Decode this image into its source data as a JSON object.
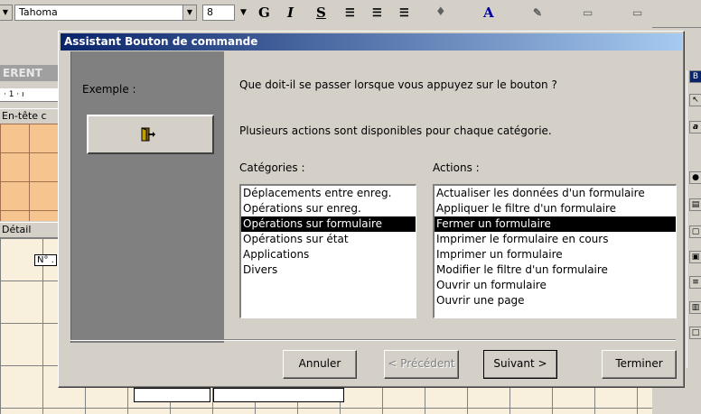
{
  "toolbar": {
    "font_name": "Tahoma",
    "font_size": "8",
    "bold_glyph": "G",
    "italic_glyph": "I",
    "underline_glyph": "S",
    "font_color_glyph": "A"
  },
  "background": {
    "title_fragment": "ERENT",
    "ruler_text": "· 1 · ı",
    "header_section": "En-tête c",
    "detail_section": "Détail",
    "field_fragment": "N° ."
  },
  "dialog": {
    "title": "Assistant Bouton de commande",
    "example_label": "Exemple :",
    "question": "Que doit-il se passer lorsque vous appuyez sur le bouton ?",
    "info": "Plusieurs actions sont disponibles pour chaque catégorie.",
    "categories_label": "Catégories :",
    "actions_label": "Actions :",
    "categories": [
      {
        "label": "Déplacements entre enreg.",
        "selected": false
      },
      {
        "label": "Opérations sur enreg.",
        "selected": false
      },
      {
        "label": "Opérations sur formulaire",
        "selected": true
      },
      {
        "label": "Opérations sur état",
        "selected": false
      },
      {
        "label": "Applications",
        "selected": false
      },
      {
        "label": "Divers",
        "selected": false
      }
    ],
    "actions": [
      {
        "label": "Actualiser les données d'un formulaire",
        "selected": false
      },
      {
        "label": "Appliquer le filtre d'un formulaire",
        "selected": false
      },
      {
        "label": "Fermer un formulaire",
        "selected": true
      },
      {
        "label": "Imprimer le formulaire en cours",
        "selected": false
      },
      {
        "label": "Imprimer un formulaire",
        "selected": false
      },
      {
        "label": "Modifier le filtre d'un formulaire",
        "selected": false
      },
      {
        "label": "Ouvrir un formulaire",
        "selected": false
      },
      {
        "label": "Ouvrir une page",
        "selected": false
      }
    ],
    "buttons": {
      "cancel": "Annuler",
      "previous": "< Précédent",
      "next": "Suivant >",
      "finish": "Terminer"
    },
    "preview_icon": "exit-door-icon"
  },
  "colors": {
    "title_bar_start": "#0a246a",
    "title_bar_end": "#a6caf0",
    "selection": "#000000",
    "panel": "#808080"
  }
}
